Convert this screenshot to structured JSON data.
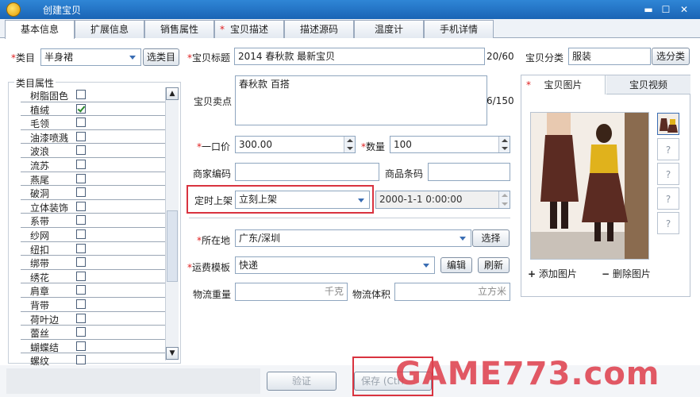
{
  "window": {
    "title": "创建宝贝",
    "min": "▬",
    "max": "☐",
    "close": "✕"
  },
  "tabs": [
    {
      "label": "基本信息",
      "required": false
    },
    {
      "label": "扩展信息",
      "required": false
    },
    {
      "label": "销售属性",
      "required": false
    },
    {
      "label": "宝贝描述",
      "required": true
    },
    {
      "label": "描述源码",
      "required": false
    },
    {
      "label": "温度计",
      "required": false
    },
    {
      "label": "手机详情",
      "required": false
    }
  ],
  "category": {
    "label": "类目",
    "value": "半身裙",
    "button": "选类目"
  },
  "attributes": {
    "legend": "类目属性",
    "items": [
      {
        "name": "树脂固色",
        "checked": false
      },
      {
        "name": "植绒",
        "checked": true
      },
      {
        "name": "毛领",
        "checked": false
      },
      {
        "name": "油漆喷溅",
        "checked": false
      },
      {
        "name": "波浪",
        "checked": false
      },
      {
        "name": "流苏",
        "checked": false
      },
      {
        "name": "燕尾",
        "checked": false
      },
      {
        "name": "破洞",
        "checked": false
      },
      {
        "name": "立体装饰",
        "checked": false
      },
      {
        "name": "系带",
        "checked": false
      },
      {
        "name": "纱网",
        "checked": false
      },
      {
        "name": "纽扣",
        "checked": false
      },
      {
        "name": "绑带",
        "checked": false
      },
      {
        "name": "绣花",
        "checked": false
      },
      {
        "name": "肩章",
        "checked": false
      },
      {
        "name": "背带",
        "checked": false
      },
      {
        "name": "荷叶边",
        "checked": false
      },
      {
        "name": "蕾丝",
        "checked": false
      },
      {
        "name": "蝴蝶结",
        "checked": false
      },
      {
        "name": "螺纹",
        "checked": false
      }
    ]
  },
  "form": {
    "title_label": "宝贝标题",
    "title_value": "2014 春秋款 最新宝贝",
    "title_count": "20/60",
    "selling_label": "宝贝卖点",
    "selling_value": "春秋款 百搭",
    "selling_count": "6/150",
    "price_label": "一口价",
    "price_value": "300.00",
    "qty_label": "数量",
    "qty_value": "100",
    "merchant_code_label": "商家编码",
    "barcode_label": "商品条码",
    "schedule_label": "定时上架",
    "schedule_value": "立刻上架",
    "schedule_time": "2000-1-1 0:00:00",
    "location_label": "所在地",
    "location_value": "广东/深圳",
    "location_button": "选择",
    "shipping_label": "运费模板",
    "shipping_value": "快递",
    "edit_button": "编辑",
    "refresh_button": "刷新",
    "weight_label": "物流重量",
    "weight_unit": "千克",
    "volume_label": "物流体积",
    "volume_unit": "立方米"
  },
  "classify": {
    "label": "宝贝分类",
    "value": "服装",
    "button": "选分类"
  },
  "images": {
    "tab_images": "宝贝图片",
    "tab_video": "宝贝视频",
    "placeholder": "?",
    "add": "添加图片",
    "delete": "删除图片"
  },
  "footer": {
    "verify": "验证",
    "save": "保存 (Ctrl",
    "watermark": "GAME773.com"
  },
  "colors": {
    "accent": "#1a64b5",
    "required": "#e02020",
    "highlight": "#d9333f"
  }
}
